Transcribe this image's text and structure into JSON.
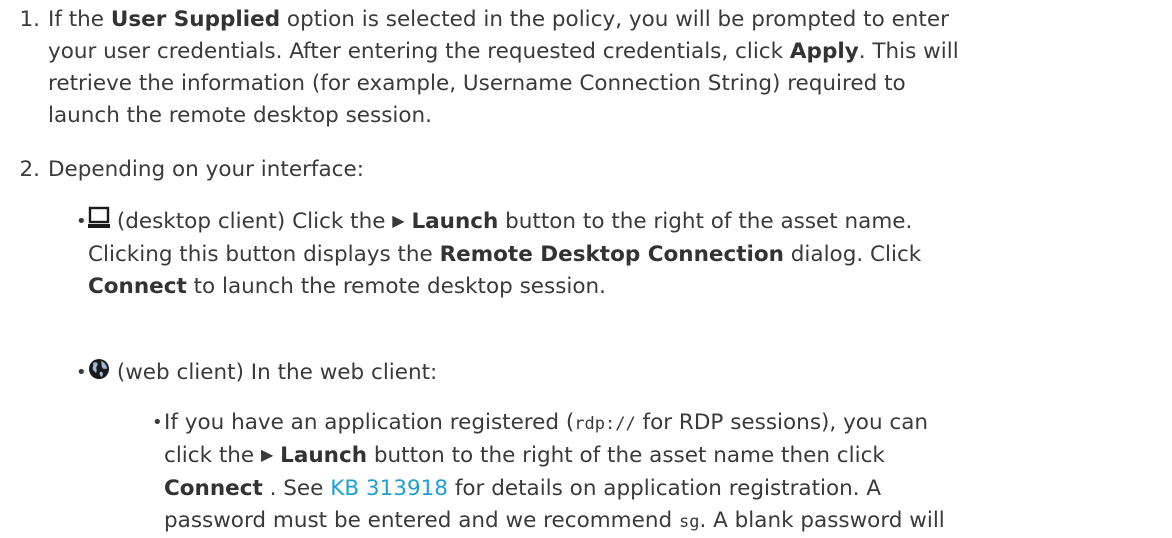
{
  "steps": [
    {
      "number": "1.",
      "t1": "If the ",
      "b1": "User Supplied",
      "t2": " option is selected in the policy, you will be prompted to enter",
      "t3": "your user credentials. After entering the requested credentials, click ",
      "b2": "Apply",
      "t4": ". This will",
      "t5": "retrieve the information (for example, Username Connection String) required to",
      "t6": "launch the remote desktop session."
    },
    {
      "number": "2.",
      "text": "Depending on your interface:"
    }
  ],
  "desktop": {
    "icon": "laptop-icon",
    "t1": " (desktop client) Click the ",
    "tri": "▶",
    "b1": "Launch",
    "t2": " button to the right of the asset name.",
    "t3": "Clicking this button displays the ",
    "b2": "Remote Desktop Connection",
    "t4": " dialog. Click",
    "b3": "Connect",
    "t5": " to launch the remote desktop session."
  },
  "web": {
    "icon": "globe-icon",
    "t1": " (web client) In the web client:"
  },
  "sub": {
    "t1": "If you have an application registered (",
    "code1": "rdp://",
    "t2": " for RDP sessions), you can",
    "t3": "click the ",
    "tri": "▶",
    "b1": "Launch",
    "t4": " button to the right of the asset name then click",
    "b2": "Connect",
    "t5": " . See ",
    "link": "KB 313918",
    "t6": " for details on application registration. A",
    "t7": "password must be entered and we recommend ",
    "code2": "sg",
    "t8": ". A blank password will"
  },
  "colors": {
    "text": "#3a3a3a",
    "link": "#1ea0d6"
  }
}
